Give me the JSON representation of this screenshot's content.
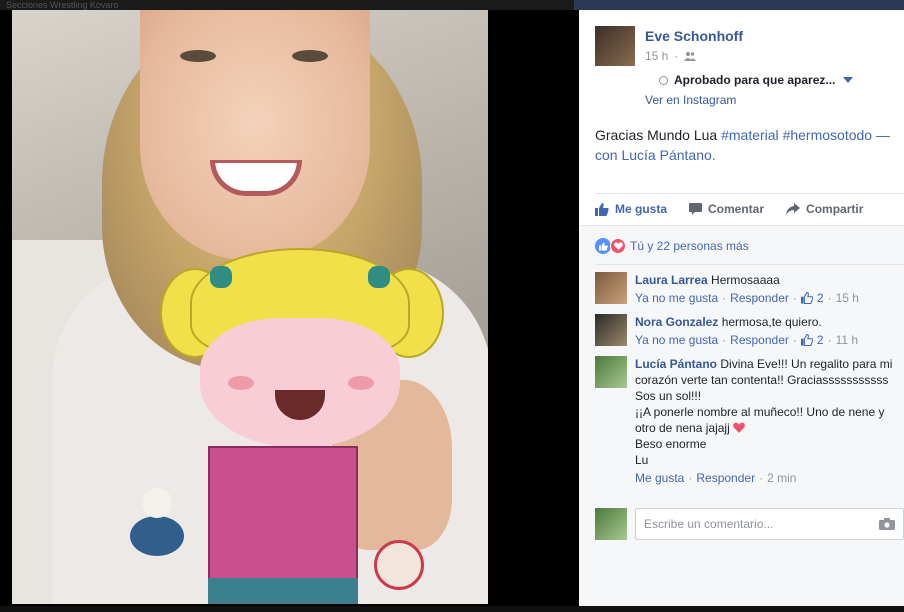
{
  "top_strip_text": "Secciones Wrestling Kovaro",
  "post": {
    "author": "Eve Schonhoff",
    "time": "15 h",
    "separator": "·",
    "approved_label": "Aprobado para que aparez...",
    "view_on_instagram": "Ver en Instagram",
    "text_plain": "Gracias Mundo Lua ",
    "hashtag1": "#material",
    "hashtag2": "#hermosotodo",
    "with_dash": " —",
    "with_label": "con ",
    "tagged": "Lucía Pántano",
    "tagged_period": "."
  },
  "actions": {
    "like": "Me gusta",
    "comment": "Comentar",
    "share": "Compartir"
  },
  "reactions": {
    "summary": "Tú y 22 personas más"
  },
  "comments": [
    {
      "author": "Laura Larrea",
      "text": "Hermosaaaa",
      "unlike": "Ya no me gusta",
      "reply": "Responder",
      "likes": "2",
      "time": "15 h"
    },
    {
      "author": "Nora Gonzalez",
      "text": "hermosa,te quiero.",
      "unlike": "Ya no me gusta",
      "reply": "Responder",
      "likes": "2",
      "time": "11 h"
    },
    {
      "author": "Lucía Pántano",
      "text_line1": "Divina Eve!!! Un regalito para mi corazón verte tan contenta!! Graciasssssssssss",
      "text_line2": "Sos un sol!!!",
      "text_line3": "¡¡A ponerle nombre al muñeco!! Uno de nene y otro de nena jajajj",
      "text_line4": "Beso enorme",
      "text_line5": "Lu",
      "like": "Me gusta",
      "reply": "Responder",
      "time": "2 min"
    }
  ],
  "compose": {
    "placeholder": "Escribe un comentario..."
  },
  "colors": {
    "link": "#365899",
    "accent": "#4267b2",
    "love": "#f25268"
  }
}
